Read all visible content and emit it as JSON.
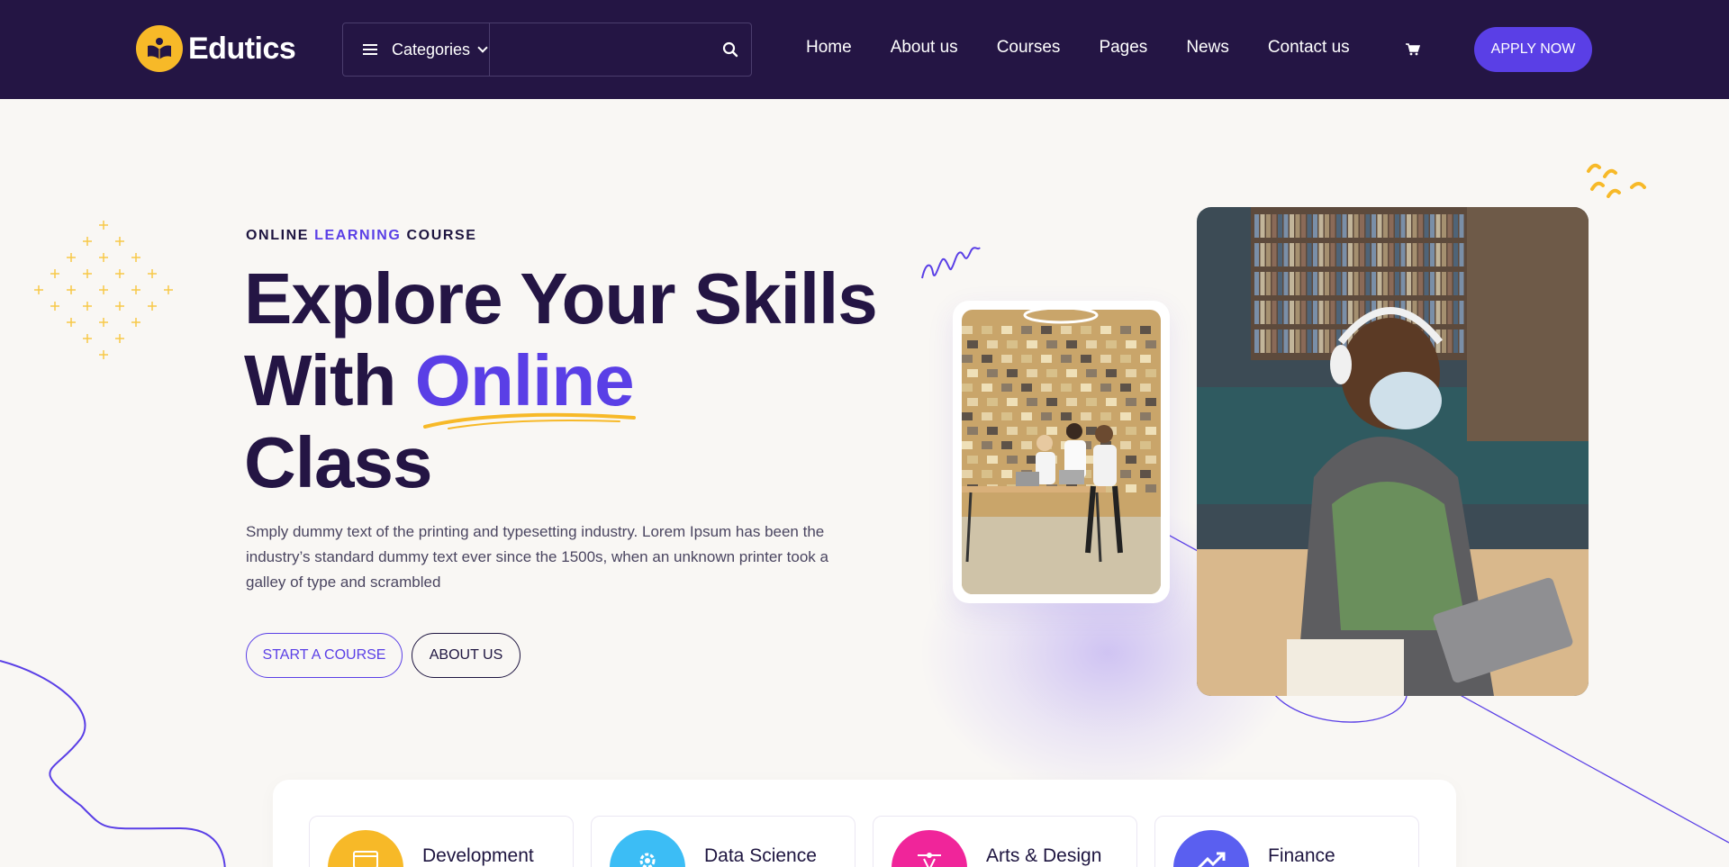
{
  "brand": {
    "name": "Edutics"
  },
  "search": {
    "category_label": "Categories",
    "placeholder": ""
  },
  "nav": {
    "items": [
      "Home",
      "About us",
      "Courses",
      "Pages",
      "News",
      "Contact us"
    ]
  },
  "header": {
    "apply_label": "APPLY NOW"
  },
  "hero": {
    "eyebrow_1": "ONLINE ",
    "eyebrow_accent": "LEARNING",
    "eyebrow_2": " COURSE",
    "headline_1": "Explore Your Skills",
    "headline_2a": "With ",
    "headline_2b": "Online",
    "headline_3": "Class",
    "description": "Smply dummy text of the printing and typesetting industry. Lorem Ipsum has been the industry’s standard dummy text ever since the 1500s, when an unknown printer took a galley of type and scrambled",
    "start_label": "START A COURSE",
    "about_label": "ABOUT US"
  },
  "categories": [
    {
      "name": "Development",
      "color": "#f7b928",
      "icon": "browser-icon"
    },
    {
      "name": "Data Science",
      "color": "#3cbdf5",
      "icon": "gear-icon"
    },
    {
      "name": "Arts & Design",
      "color": "#f0259a",
      "icon": "pen-tool-icon"
    },
    {
      "name": "Finance",
      "color": "#5a5ff0",
      "icon": "trend-up-icon"
    }
  ],
  "colors": {
    "primary": "#5a3fe6",
    "header_bg": "#241544",
    "accent_yellow": "#f7b928",
    "page_bg": "#f9f7f4"
  }
}
